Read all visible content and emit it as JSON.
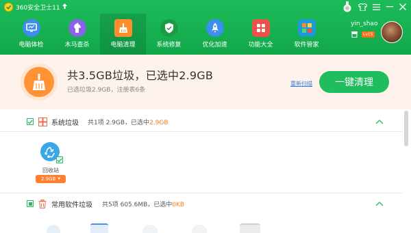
{
  "window": {
    "app_title": "360安全卫士11",
    "icon_names": [
      "tshirt-icon",
      "menu-icon",
      "minimize-icon",
      "close-icon"
    ]
  },
  "nav": [
    {
      "label": "电脑体检",
      "icon": "monitor-icon",
      "color": "#3d8ef0",
      "active": false
    },
    {
      "label": "木马查杀",
      "icon": "horse-icon",
      "color": "#8a63e8",
      "active": false
    },
    {
      "label": "电脑清理",
      "icon": "broom-icon",
      "color": "#ff8d2e",
      "active": true
    },
    {
      "label": "系统修复",
      "icon": "shield-icon",
      "color": "#1c9b45",
      "active": false
    },
    {
      "label": "优化加速",
      "icon": "rocket-icon",
      "color": "#3a8ff0",
      "active": false
    },
    {
      "label": "功能大全",
      "icon": "grid-icon",
      "color": "#f0504a",
      "active": false
    },
    {
      "label": "软件管家",
      "icon": "apps-icon",
      "color": "#1e9ad6",
      "active": false
    }
  ],
  "user": {
    "name": "yin_shao",
    "level": "Lv15"
  },
  "summary": {
    "title": "共3.5GB垃圾，已选中2.9GB",
    "subtitle": "已选垃圾2.9GB，注册表6条",
    "rescan_label": "重新扫描",
    "clean_button": "一键清理"
  },
  "sections": [
    {
      "name": "系统垃圾",
      "stats_prefix": "共1项 2.9GB，已选中",
      "stats_selected": "2.9GB",
      "checked": "full",
      "items": [
        {
          "label": "回收站",
          "size": "2.9GB",
          "checked": true
        }
      ]
    },
    {
      "name": "常用软件垃圾",
      "stats_prefix": "共5项 605.6MB，已选中",
      "stats_selected": "0KB",
      "checked": "partial",
      "items": []
    }
  ],
  "colors": {
    "header_green": "#1dbb5a",
    "accent_orange": "#ff7a14",
    "button_green": "#1fbd5d",
    "link_blue": "#3a7be0"
  }
}
